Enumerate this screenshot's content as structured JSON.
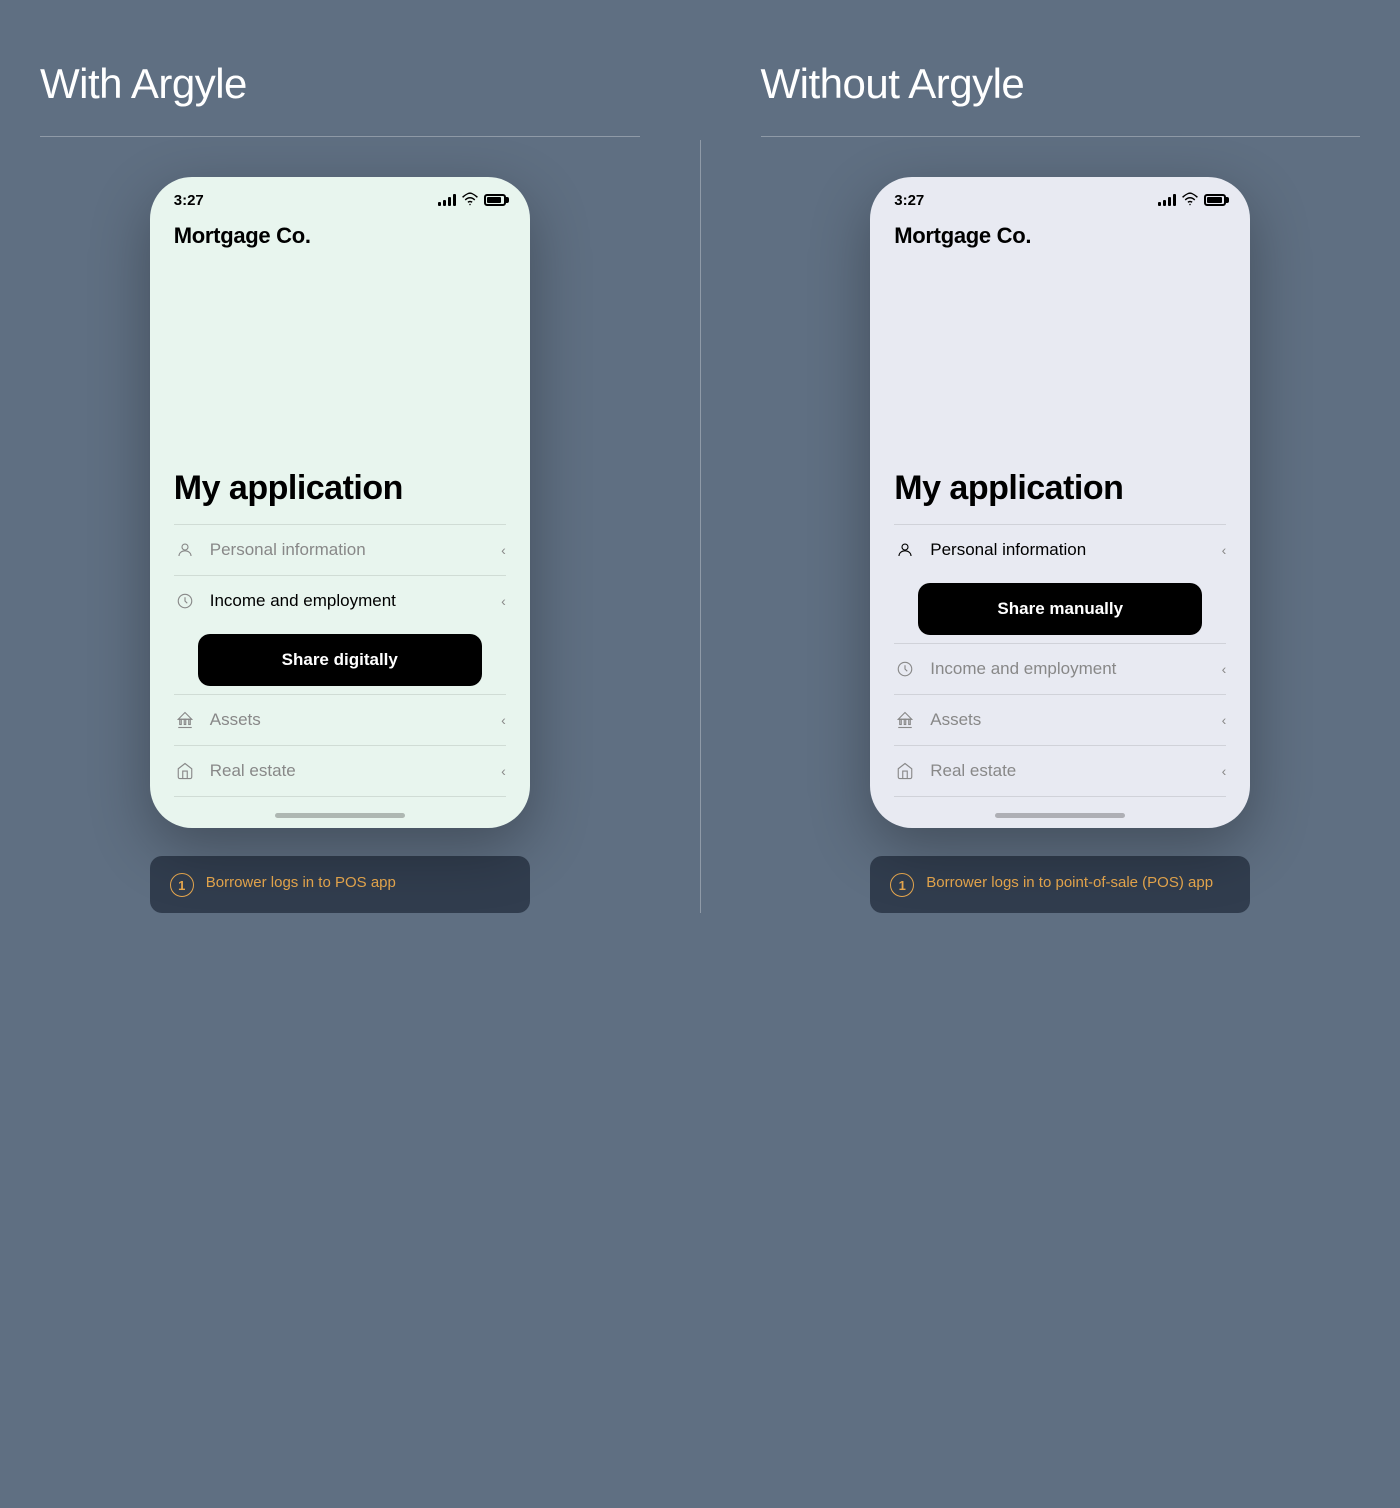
{
  "columns": [
    {
      "id": "with-argyle",
      "title": "With Argyle",
      "phone_bg": "#e8f5ee",
      "status_time": "3:27",
      "brand": "Mortgage Co.",
      "app_title": "My application",
      "menu_items": [
        {
          "icon": "person",
          "label": "Personal information",
          "active": false
        },
        {
          "icon": "clock",
          "label": "Income and employment",
          "active": true
        },
        {
          "label_button": "Share digitally"
        },
        {
          "icon": "bank",
          "label": "Assets",
          "active": false
        },
        {
          "icon": "home",
          "label": "Real estate",
          "active": false
        }
      ],
      "caption_number": "1",
      "caption_text": "Borrower logs in to POS app"
    },
    {
      "id": "without-argyle",
      "title": "Without Argyle",
      "phone_bg": "#e8eaf2",
      "status_time": "3:27",
      "brand": "Mortgage Co.",
      "app_title": "My application",
      "menu_items": [
        {
          "icon": "person",
          "label": "Personal information",
          "active": true
        },
        {
          "label_button": "Share manually"
        },
        {
          "icon": "clock",
          "label": "Income and employment",
          "active": false
        },
        {
          "icon": "bank",
          "label": "Assets",
          "active": false
        },
        {
          "icon": "home",
          "label": "Real estate",
          "active": false
        }
      ],
      "caption_number": "1",
      "caption_text": "Borrower logs in to point-of-sale (POS) app"
    }
  ]
}
